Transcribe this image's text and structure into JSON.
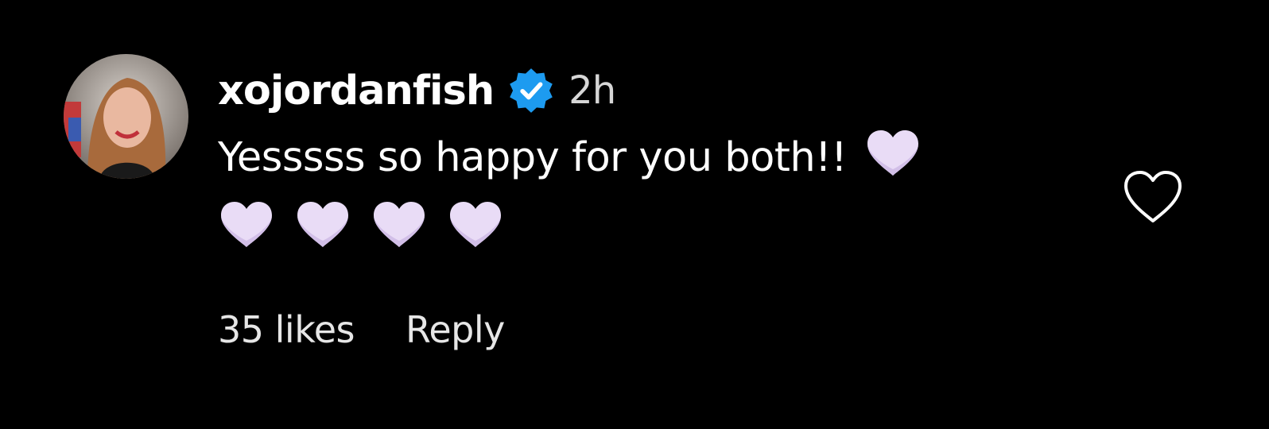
{
  "comment": {
    "username": "xojordanfish",
    "verified": true,
    "timestamp": "2h",
    "text": "Yesssss so happy for you both!!",
    "hearts_line1": 1,
    "hearts_line2": 4,
    "heart_emoji": "white-heart-emoji",
    "likes_label": "35 likes",
    "reply_label": "Reply"
  },
  "colors": {
    "background": "#000000",
    "verified_badge": "#1d9bf0",
    "heart_fill": "#e9dcf6"
  },
  "icons": {
    "verified": "verified-badge-icon",
    "like": "heart-outline-icon"
  }
}
